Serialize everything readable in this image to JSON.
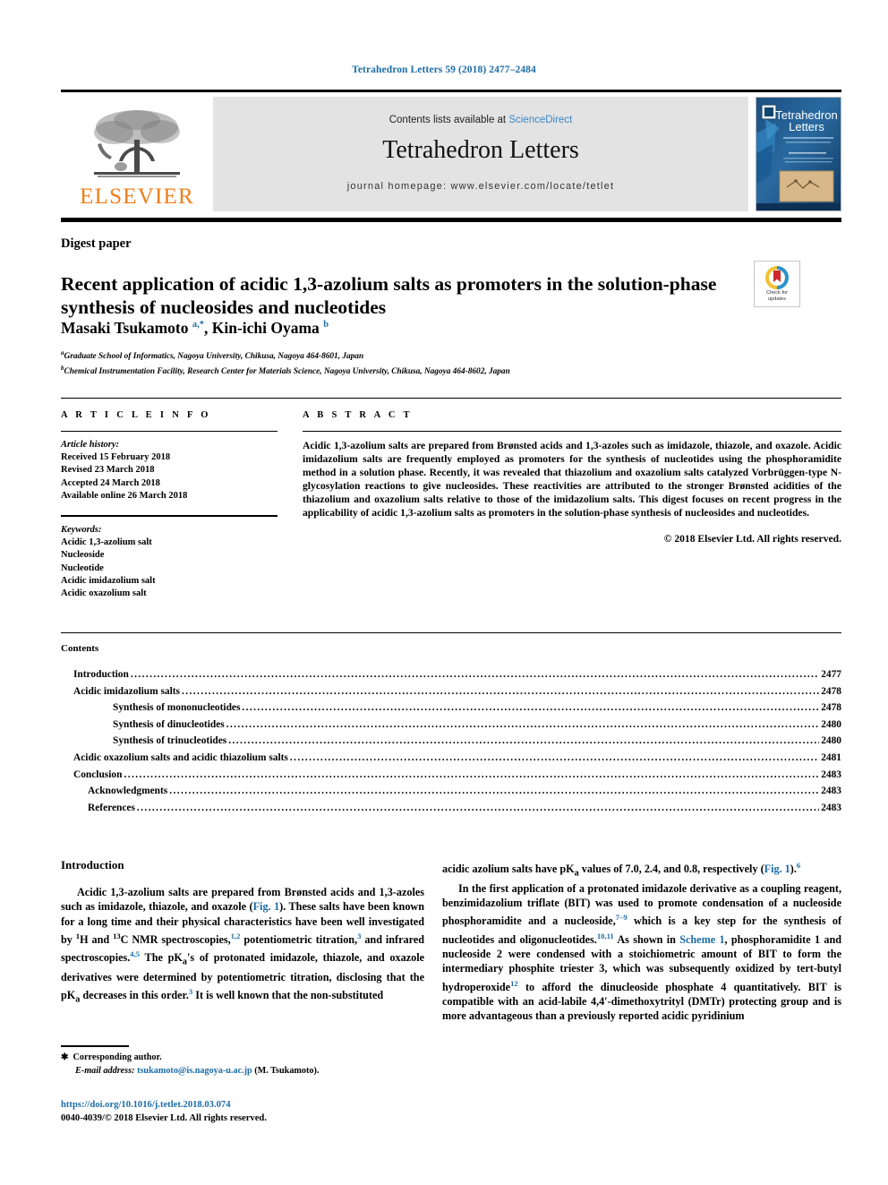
{
  "running_head": "Tetrahedron Letters 59 (2018) 2477–2484",
  "masthead": {
    "publisher": "ELSEVIER",
    "contents_prefix": "Contents lists available at ",
    "sciencedirect": "ScienceDirect",
    "journal_title": "Tetrahedron Letters",
    "homepage": "journal homepage: www.elsevier.com/locate/tetlet",
    "cover_title_line1": "Tetrahedron",
    "cover_title_line2": "Letters"
  },
  "article": {
    "type_label": "Digest paper",
    "title": "Recent application of acidic 1,3-azolium salts as promoters in the solution-phase synthesis of nucleosides and nucleotides",
    "crossmark_line1": "Check for",
    "crossmark_line2": "updates",
    "authors_html": "Masaki Tsukamoto <sup>a,*</sup>, Kin-ichi Oyama <sup>b</sup>",
    "affiliation_a": "Graduate School of Informatics, Nagoya University, Chikusa, Nagoya 464-8601, Japan",
    "affiliation_b": "Chemical Instrumentation Facility, Research Center for Materials Science, Nagoya University, Chikusa, Nagoya 464-8602, Japan"
  },
  "article_info": {
    "heading": "A R T I C L E    I N F O",
    "history_title": "Article history:",
    "history": [
      "Received 15 February 2018",
      "Revised 23 March 2018",
      "Accepted 24 March 2018",
      "Available online 26 March 2018"
    ],
    "keywords_title": "Keywords:",
    "keywords": [
      "Acidic 1,3-azolium salt",
      "Nucleoside",
      "Nucleotide",
      "Acidic imidazolium salt",
      "Acidic oxazolium salt"
    ]
  },
  "abstract": {
    "heading": "A B S T R A C T",
    "text": "Acidic 1,3-azolium salts are prepared from Brønsted acids and 1,3-azoles such as imidazole, thiazole, and oxazole. Acidic imidazolium salts are frequently employed as promoters for the synthesis of nucleotides using the phosphoramidite method in a solution phase. Recently, it was revealed that thiazolium and oxazolium salts catalyzed Vorbrüggen-type N-glycosylation reactions to give nucleosides. These reactivities are attributed to the stronger Brønsted acidities of the thiazolium and oxazolium salts relative to those of the imidazolium salts. This digest focuses on recent progress in the applicability of acidic 1,3-azolium salts as promoters in the solution-phase synthesis of nucleosides and nucleotides.",
    "copyright": "© 2018 Elsevier Ltd. All rights reserved."
  },
  "contents": {
    "title": "Contents",
    "entries": [
      {
        "label": "Introduction",
        "page": "2477",
        "level": 1
      },
      {
        "label": "Acidic imidazolium salts",
        "page": "2478",
        "level": 1
      },
      {
        "label": "Synthesis of mononucleotides",
        "page": "2478",
        "level": 2
      },
      {
        "label": "Synthesis of dinucleotides",
        "page": "2480",
        "level": 2
      },
      {
        "label": "Synthesis of trinucleotides",
        "page": "2480",
        "level": 2
      },
      {
        "label": "Acidic oxazolium salts and acidic thiazolium salts",
        "page": "2481",
        "level": 1
      },
      {
        "label": "Conclusion",
        "page": "2483",
        "level": 1
      },
      {
        "label": "Acknowledgments",
        "page": "2483",
        "level": 3
      },
      {
        "label": "References",
        "page": "2483",
        "level": 3
      }
    ]
  },
  "body": {
    "intro_heading": "Introduction",
    "left_paragraph_html": "Acidic 1,3-azolium salts are prepared from Brønsted acids and 1,3-azoles such as imidazole, thiazole, and oxazole (<span class=\"lnk\">Fig. 1</span>). These salts have been known for a long time and their physical characteristics have been well investigated by <sup>1</sup>H and <sup>13</sup>C NMR spectroscopies,<sup class=\"lnk\">1,2</sup> potentiometric titration,<sup class=\"lnk\">3</sup> and infrared spectroscopies.<sup class=\"lnk\">4,5</sup> The pK<sub>a</sub>'s of protonated imidazole, thiazole, and oxazole derivatives were determined by potentiometric titration, disclosing that the pK<sub>a</sub> decreases in this order.<sup class=\"lnk\">3</sup> It is well known that the non-substituted",
    "right_paragraph1_html": "acidic azolium salts have pK<sub>a</sub> values of 7.0, 2.4, and 0.8, respectively (<span class=\"lnk\">Fig. 1</span>).<sup class=\"lnk\">6</sup>",
    "right_paragraph2_html": "In the first application of a protonated imidazole derivative as a coupling reagent, benzimidazolium triflate (BIT) was used to promote condensation of a nucleoside phosphoramidite and a nucleoside,<sup class=\"lnk\">7–9</sup> which is a key step for the synthesis of nucleotides and oligonucleotides.<sup class=\"lnk\">10,11</sup> As shown in <span class=\"lnk\">Scheme 1</span>, phosphoramidite <b>1</b> and nucleoside <b>2</b> were condensed with a stoichiometric amount of BIT to form the intermediary phosphite triester <b>3</b>, which was subsequently oxidized by tert-butyl hydroperoxide<sup class=\"lnk\">12</sup> to afford the dinucleoside phosphate <b>4</b> quantitatively. BIT is compatible with an acid-labile 4,4′-dimethoxytrityl (DMTr) protecting group and is more advantageous than a previously reported acidic pyridinium"
  },
  "footer": {
    "corresponding_author": "Corresponding author.",
    "email_label": "E-mail address:",
    "email": "tsukamoto@is.nagoya-u.ac.jp",
    "email_suffix": "(M. Tsukamoto).",
    "doi": "https://doi.org/10.1016/j.tetlet.2018.03.074",
    "issn_line": "0040-4039/© 2018 Elsevier Ltd. All rights reserved."
  },
  "colors": {
    "link_blue": "#1b6ca8",
    "sciencedirect_blue": "#3a87c8",
    "elsevier_orange": "#ef7d1a",
    "masthead_grey": "#e3e3e3"
  }
}
